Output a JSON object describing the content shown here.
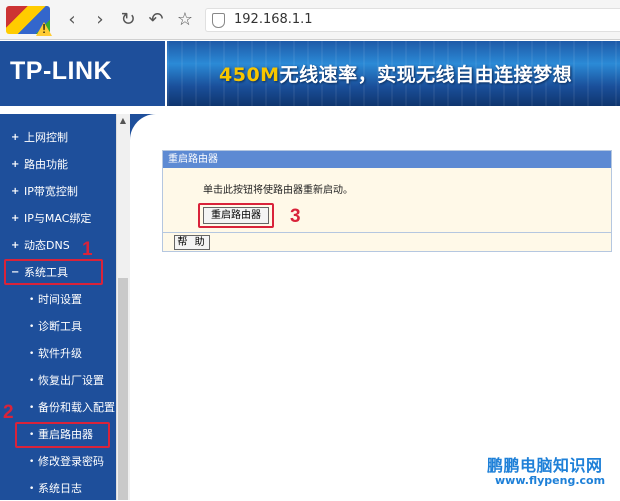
{
  "browser": {
    "url": "192.168.1.1",
    "back_glyph": "‹",
    "forward_glyph": "›",
    "reload_glyph": "↻",
    "undo_glyph": "↶",
    "star_glyph": "☆",
    "warn_glyph": "!"
  },
  "header": {
    "logo": "TP-LINK",
    "slogan_highlight": "450M",
    "slogan_rest": "无线速率，实现无线自由连接梦想"
  },
  "sidebar": {
    "items": [
      {
        "label": "上网控制",
        "level": "top"
      },
      {
        "label": "路由功能",
        "level": "top"
      },
      {
        "label": "IP带宽控制",
        "level": "top"
      },
      {
        "label": "IP与MAC绑定",
        "level": "top"
      },
      {
        "label": "动态DNS",
        "level": "top"
      },
      {
        "label": "系统工具",
        "level": "top",
        "expanded": true
      },
      {
        "label": "时间设置",
        "level": "sub"
      },
      {
        "label": "诊断工具",
        "level": "sub"
      },
      {
        "label": "软件升级",
        "level": "sub"
      },
      {
        "label": "恢复出厂设置",
        "level": "sub"
      },
      {
        "label": "备份和载入配置",
        "level": "sub"
      },
      {
        "label": "重启路由器",
        "level": "sub",
        "active": true
      },
      {
        "label": "修改登录密码",
        "level": "sub"
      },
      {
        "label": "系统日志",
        "level": "sub"
      }
    ]
  },
  "panel": {
    "title": "重启路由器",
    "description": "单击此按钮将使路由器重新启动。",
    "reboot_button": "重启路由器",
    "help_button": "帮 助"
  },
  "annotations": {
    "step1": "1",
    "step2": "2",
    "step3": "3"
  },
  "watermark": {
    "line1": "鹏鹏电脑知识网",
    "line2": "www.flypeng.com"
  },
  "colors": {
    "nav_blue": "#1e4f9b",
    "panel_title": "#5d8ad3",
    "panel_body": "#fff9e8",
    "annotation_red": "#d9233a",
    "watermark_blue": "#1e80d8"
  }
}
